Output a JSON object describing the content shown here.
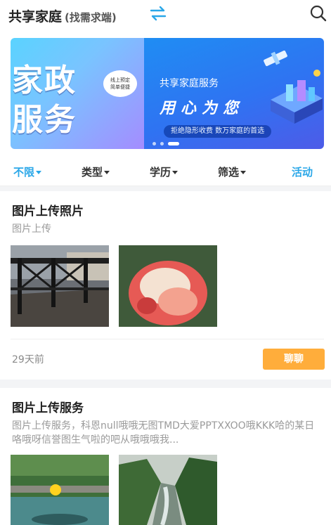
{
  "header": {
    "title": "共享家庭",
    "subtitle": "(找需求端)",
    "switch_icon": "swap-arrows-icon",
    "search_icon": "search-icon",
    "accent_color": "#2aa7e8"
  },
  "banner": {
    "left": {
      "line1": "家政",
      "line2": "服务",
      "bubble_line1": "线上预定",
      "bubble_line2": "简单便捷"
    },
    "right": {
      "heading": "共享家庭服务",
      "slogan": "用心为您",
      "pill": "拒绝隐形收费  数万家庭的首选"
    },
    "active_dot": 3,
    "dot_count": 3
  },
  "filters": [
    {
      "label": "不限",
      "has_caret": true,
      "active": true
    },
    {
      "label": "类型",
      "has_caret": true,
      "active": false
    },
    {
      "label": "学历",
      "has_caret": true,
      "active": false
    },
    {
      "label": "筛选",
      "has_caret": true,
      "active": false
    },
    {
      "label": "活动",
      "has_caret": false,
      "active": true
    }
  ],
  "posts": [
    {
      "title": "图片上传照片",
      "description": "图片上传",
      "time": "29天前",
      "action_label": "聊聊"
    },
    {
      "title": "图片上传服务",
      "description": "图片上传服务，科恩null哦哦无图TMD大爱PPTXXOO哦KKK哈的某日咯哦呀信誉图生气啦的吧从哦哦哦我..."
    }
  ],
  "colors": {
    "action_button": "#ffad3b",
    "banner_left_start": "#5ad3ff",
    "banner_right_start": "#1f8df3"
  }
}
